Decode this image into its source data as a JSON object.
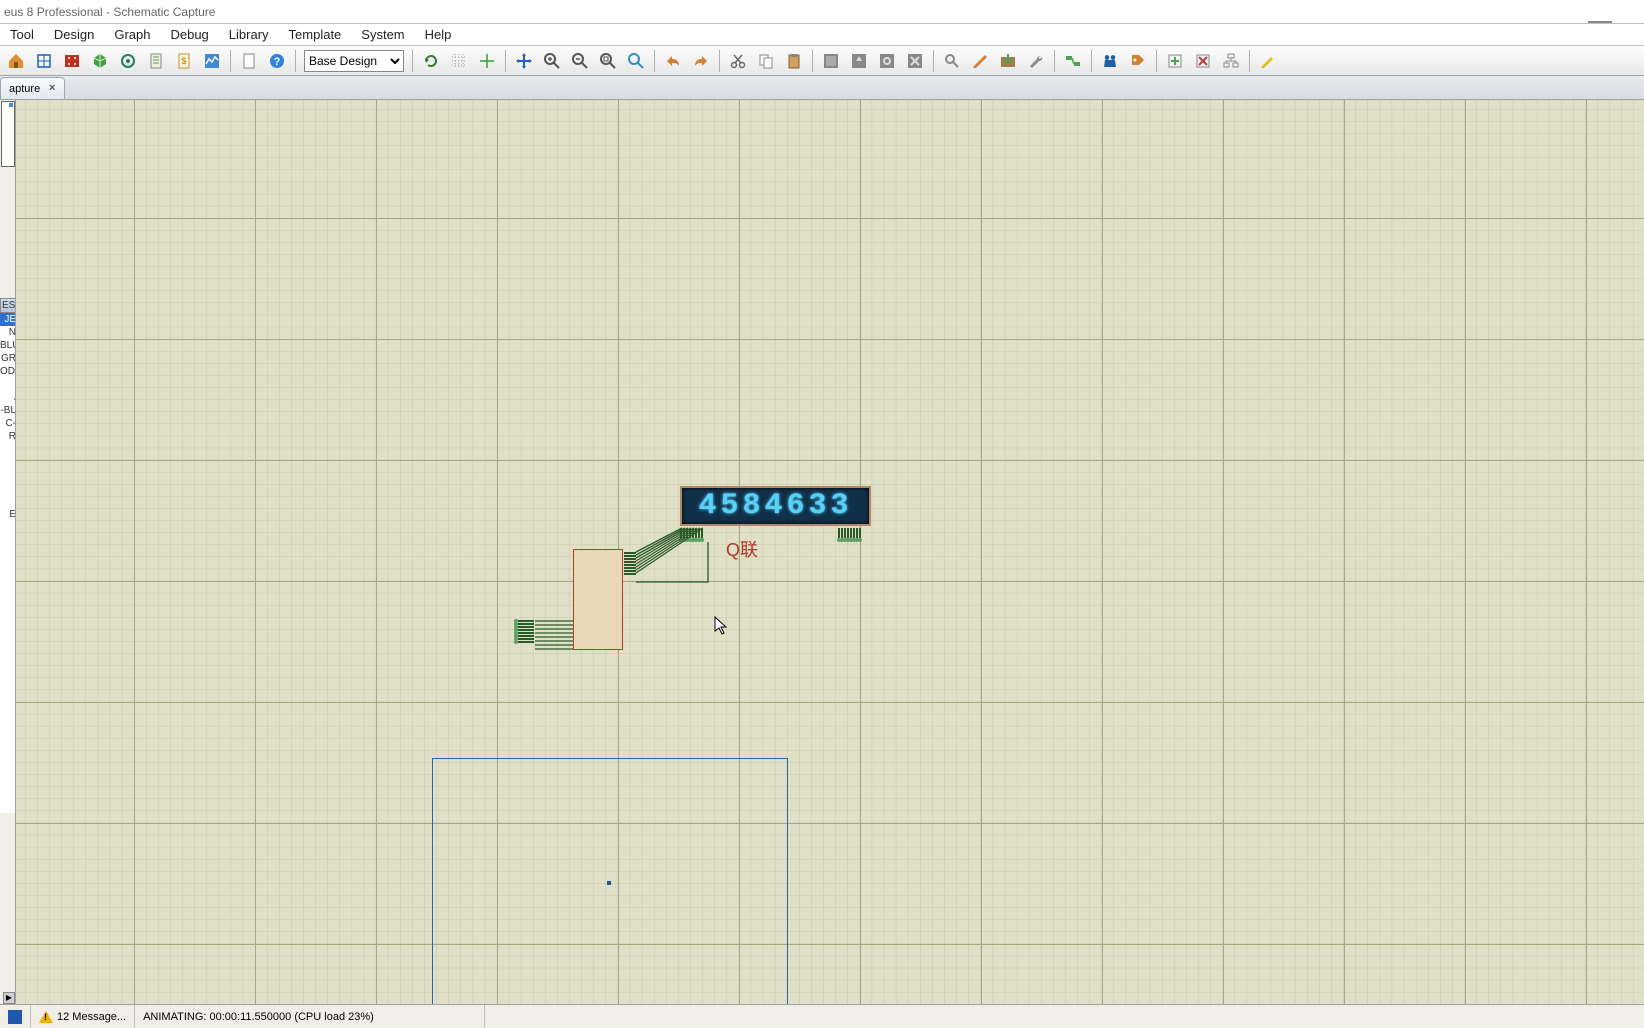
{
  "app": {
    "title_fragment": "eus 8 Professional - Schematic Capture"
  },
  "menu": {
    "items": [
      "Tool",
      "Design",
      "Graph",
      "Debug",
      "Library",
      "Template",
      "System",
      "Help"
    ]
  },
  "toolbar": {
    "variant_selected": "Base Design"
  },
  "tabs": {
    "active": "apture"
  },
  "left_panel": {
    "header": "ES",
    "items": [
      "JE",
      "N",
      "BLU",
      "GR",
      "ODE",
      ".",
      "-BL",
      "C-R",
      "",
      "",
      "",
      "E"
    ]
  },
  "schematic": {
    "display_value": "4584633",
    "label_text": "Q联"
  },
  "status": {
    "messages": "12 Message...",
    "animating": "ANIMATING: 00:00:11.550000 (CPU load 23%)"
  }
}
